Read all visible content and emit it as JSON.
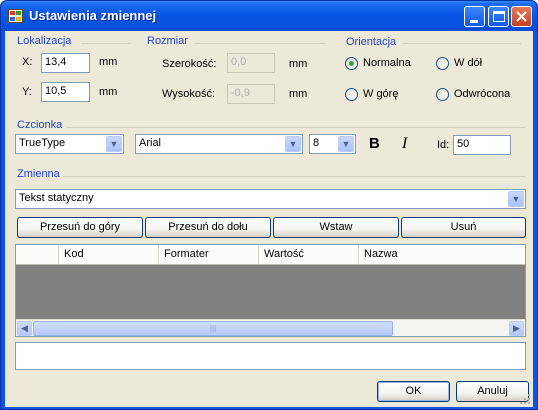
{
  "window": {
    "title": "Ustawienia zmiennej",
    "controls": {
      "minimize_icon": "minimize-icon",
      "maximize_icon": "maximize-icon",
      "close_icon": "close-icon"
    }
  },
  "lokalizacja": {
    "label": "Lokalizacja",
    "x_label": "X:",
    "x_value": "13,4",
    "x_unit": "mm",
    "y_label": "Y:",
    "y_value": "10,5",
    "y_unit": "mm"
  },
  "rozmiar": {
    "label": "Rozmiar",
    "width_label": "Szerokość:",
    "width_value": "0,0",
    "width_unit": "mm",
    "height_label": "Wysokość:",
    "height_value": "-0,9",
    "height_unit": "mm"
  },
  "orientacja": {
    "label": "Orientacja",
    "options": [
      "Normalna",
      "W dół",
      "W górę",
      "Odwrócona"
    ],
    "selected": "Normalna"
  },
  "czcionka": {
    "label": "Czcionka",
    "font_type": "TrueType",
    "font_name": "Arial",
    "font_size": "8",
    "bold_label": "B",
    "italic_label": "I",
    "id_label": "Id:",
    "id_value": "50"
  },
  "zmienna": {
    "label": "Zmienna",
    "selected": "Tekst statyczny"
  },
  "buttons": {
    "move_up": "Przesuń do góry",
    "move_down": "Przesuń do dołu",
    "insert": "Wstaw",
    "delete": "Usuń",
    "ok": "OK",
    "cancel": "Anuluj"
  },
  "table": {
    "columns": [
      "Kod",
      "Formater",
      "Wartość",
      "Nazwa"
    ],
    "rows": []
  },
  "preview": {
    "value": ""
  },
  "colors": {
    "title_bar": "#0a58e8",
    "dialog_bg": "#ece9d8",
    "group_label": "#1f46c8",
    "grid_bg": "#808080",
    "radio_checked": "#3aa03a"
  }
}
